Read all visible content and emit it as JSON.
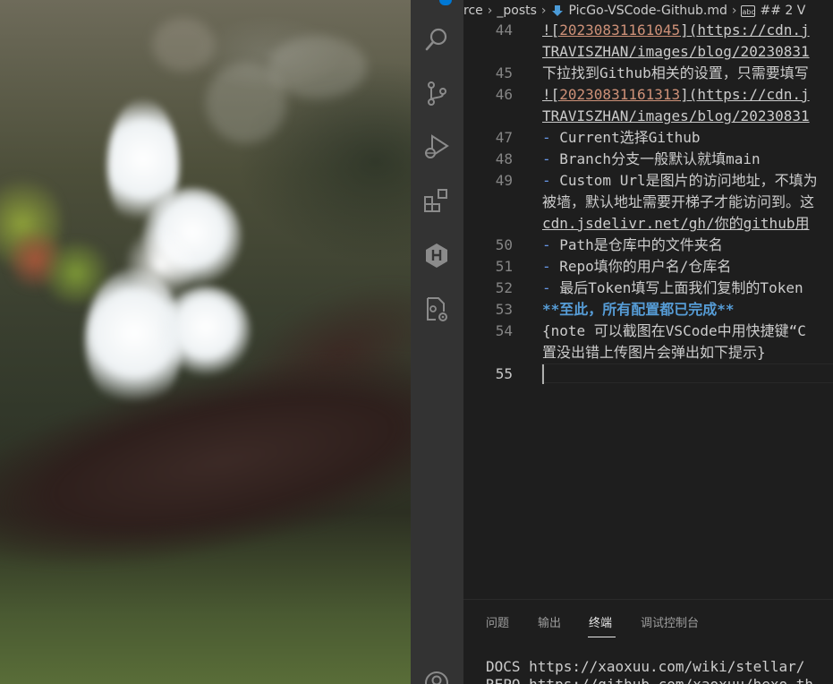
{
  "breadcrumb": {
    "items": [
      "rce",
      "_posts",
      "PicGo-VSCode-Github.md",
      "## 2 V"
    ],
    "file_icon": "markdown-icon",
    "symbol_icon": "string-symbol-icon"
  },
  "activity_bar": {
    "icons": [
      "source-control-badge-icon",
      "search-icon",
      "source-control-icon",
      "run-debug-icon",
      "extensions-icon",
      "hexo-icon",
      "remote-settings-icon",
      "account-icon"
    ],
    "accent_color": "#0078d4"
  },
  "editor": {
    "lines": [
      {
        "num": "44",
        "segments": [
          {
            "cls": "link",
            "t": "!["
          },
          {
            "cls": "link-num",
            "t": "20230831161045"
          },
          {
            "cls": "link",
            "t": "](https://cdn.j"
          }
        ]
      },
      {
        "num": "",
        "segments": [
          {
            "cls": "link",
            "t": "TRAVISZHAN/images/blog/20230831"
          }
        ]
      },
      {
        "num": "45",
        "segments": [
          {
            "cls": "plain",
            "t": "下拉找到Github相关的设置，只需要填写"
          }
        ]
      },
      {
        "num": "46",
        "segments": [
          {
            "cls": "link",
            "t": "!["
          },
          {
            "cls": "link-num",
            "t": "20230831161313"
          },
          {
            "cls": "link",
            "t": "](https://cdn.j"
          }
        ]
      },
      {
        "num": "",
        "segments": [
          {
            "cls": "link",
            "t": "TRAVISZHAN/images/blog/20230831"
          }
        ]
      },
      {
        "num": "47",
        "segments": [
          {
            "cls": "dash",
            "t": "- "
          },
          {
            "cls": "plain",
            "t": "Current选择Github"
          }
        ]
      },
      {
        "num": "48",
        "segments": [
          {
            "cls": "dash",
            "t": "- "
          },
          {
            "cls": "plain",
            "t": "Branch分支一般默认就填main"
          }
        ]
      },
      {
        "num": "49",
        "segments": [
          {
            "cls": "dash",
            "t": "- "
          },
          {
            "cls": "plain",
            "t": "Custom Url是图片的访问地址，不填为"
          }
        ]
      },
      {
        "num": "",
        "segments": [
          {
            "cls": "plain",
            "t": "被墙，默认地址需要开梯子才能访问到。这"
          }
        ]
      },
      {
        "num": "",
        "segments": [
          {
            "cls": "link",
            "t": "cdn.jsdelivr.net/gh/你的github用"
          }
        ]
      },
      {
        "num": "50",
        "segments": [
          {
            "cls": "dash",
            "t": "- "
          },
          {
            "cls": "plain",
            "t": "Path是仓库中的文件夹名"
          }
        ]
      },
      {
        "num": "51",
        "segments": [
          {
            "cls": "dash",
            "t": "- "
          },
          {
            "cls": "plain",
            "t": "Repo填你的用户名/仓库名"
          }
        ]
      },
      {
        "num": "52",
        "segments": [
          {
            "cls": "dash",
            "t": "- "
          },
          {
            "cls": "plain",
            "t": "最后Token填写上面我们复制的Token"
          }
        ]
      },
      {
        "num": "53",
        "segments": [
          {
            "cls": "bold",
            "t": "**至此，所有配置都已完成**"
          }
        ]
      },
      {
        "num": "54",
        "segments": [
          {
            "cls": "plain",
            "t": "{note 可以截图在VSCode中用快捷键“C"
          }
        ]
      },
      {
        "num": "",
        "segments": [
          {
            "cls": "plain",
            "t": "置没出错上传图片会弹出如下提示}"
          }
        ]
      },
      {
        "num": "55",
        "segments": [],
        "current": true
      }
    ]
  },
  "panel": {
    "tabs": [
      {
        "label": "问题",
        "active": false
      },
      {
        "label": "输出",
        "active": false
      },
      {
        "label": "终端",
        "active": true
      },
      {
        "label": "调试控制台",
        "active": false
      }
    ],
    "terminal_lines": [
      "DOCS  https://xaoxuu.com/wiki/stellar/",
      "REPO  https://github.com/xaoxuu/hexo-th"
    ]
  }
}
